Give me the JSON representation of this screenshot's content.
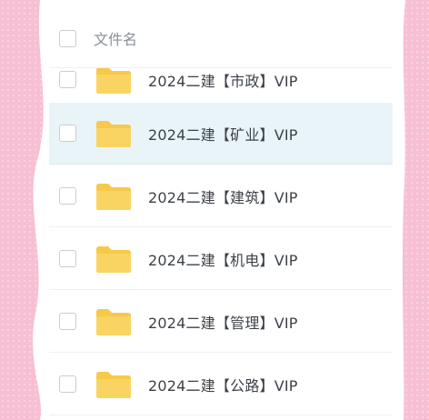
{
  "colors": {
    "background_pink": "#f7bfd4",
    "panel": "#ffffff",
    "selected_row": "#e9f4f8",
    "folder_yellow": "#f7c948",
    "text": "#3d4249",
    "header_text": "#8a8f98"
  },
  "file_list": {
    "header": {
      "column_label": "文件名"
    },
    "rows": [
      {
        "name": "2024二建【市政】VIP",
        "icon": "folder-icon",
        "selected": false
      },
      {
        "name": "2024二建【矿业】VIP",
        "icon": "folder-icon",
        "selected": true
      },
      {
        "name": "2024二建【建筑】VIP",
        "icon": "folder-icon",
        "selected": false
      },
      {
        "name": "2024二建【机电】VIP",
        "icon": "folder-icon",
        "selected": false
      },
      {
        "name": "2024二建【管理】VIP",
        "icon": "folder-icon",
        "selected": false
      },
      {
        "name": "2024二建【公路】VIP",
        "icon": "folder-icon",
        "selected": false
      }
    ]
  }
}
